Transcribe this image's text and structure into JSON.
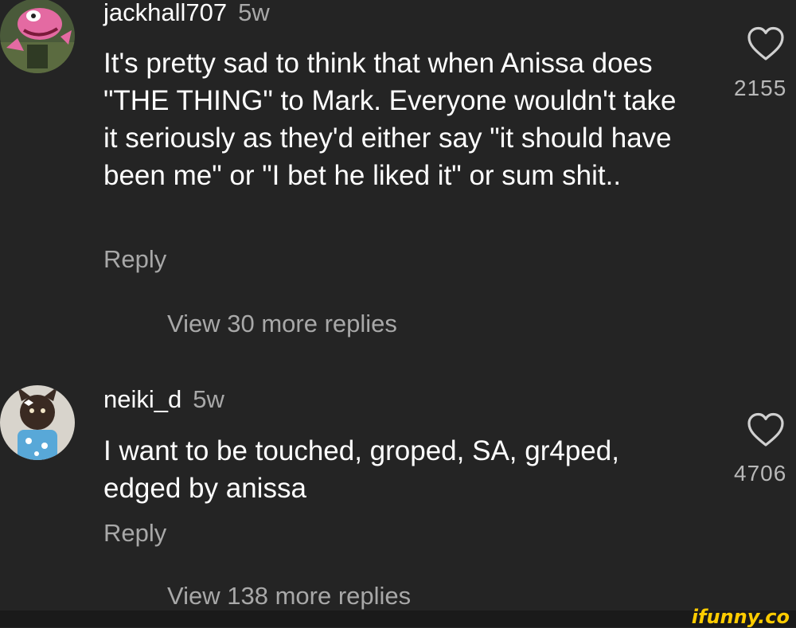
{
  "comments": [
    {
      "username": "jackhall707",
      "age": "5w",
      "text": "It's pretty sad to think that when Anissa does \"THE THING\" to Mark. Everyone wouldn't take it seriously as they'd either say \"it should have been me\" or \"I bet he liked it\" or sum shit..",
      "reply_label": "Reply",
      "view_replies_label": "View 30 more replies",
      "likes": "2155",
      "avatar_icon": "pink-cartoon-avatar-icon"
    },
    {
      "username": "neiki_d",
      "age": "5w",
      "text": "I want to be touched, groped, SA, gr4ped, edged by anissa",
      "reply_label": "Reply",
      "view_replies_label": "View 138 more replies",
      "likes": "4706",
      "avatar_icon": "furry-character-avatar-icon"
    }
  ],
  "watermark": "ifunny.co",
  "colors": {
    "background": "#242424",
    "text": "#ffffff",
    "muted": "#a8a8a8",
    "watermark": "#ffcc00"
  }
}
